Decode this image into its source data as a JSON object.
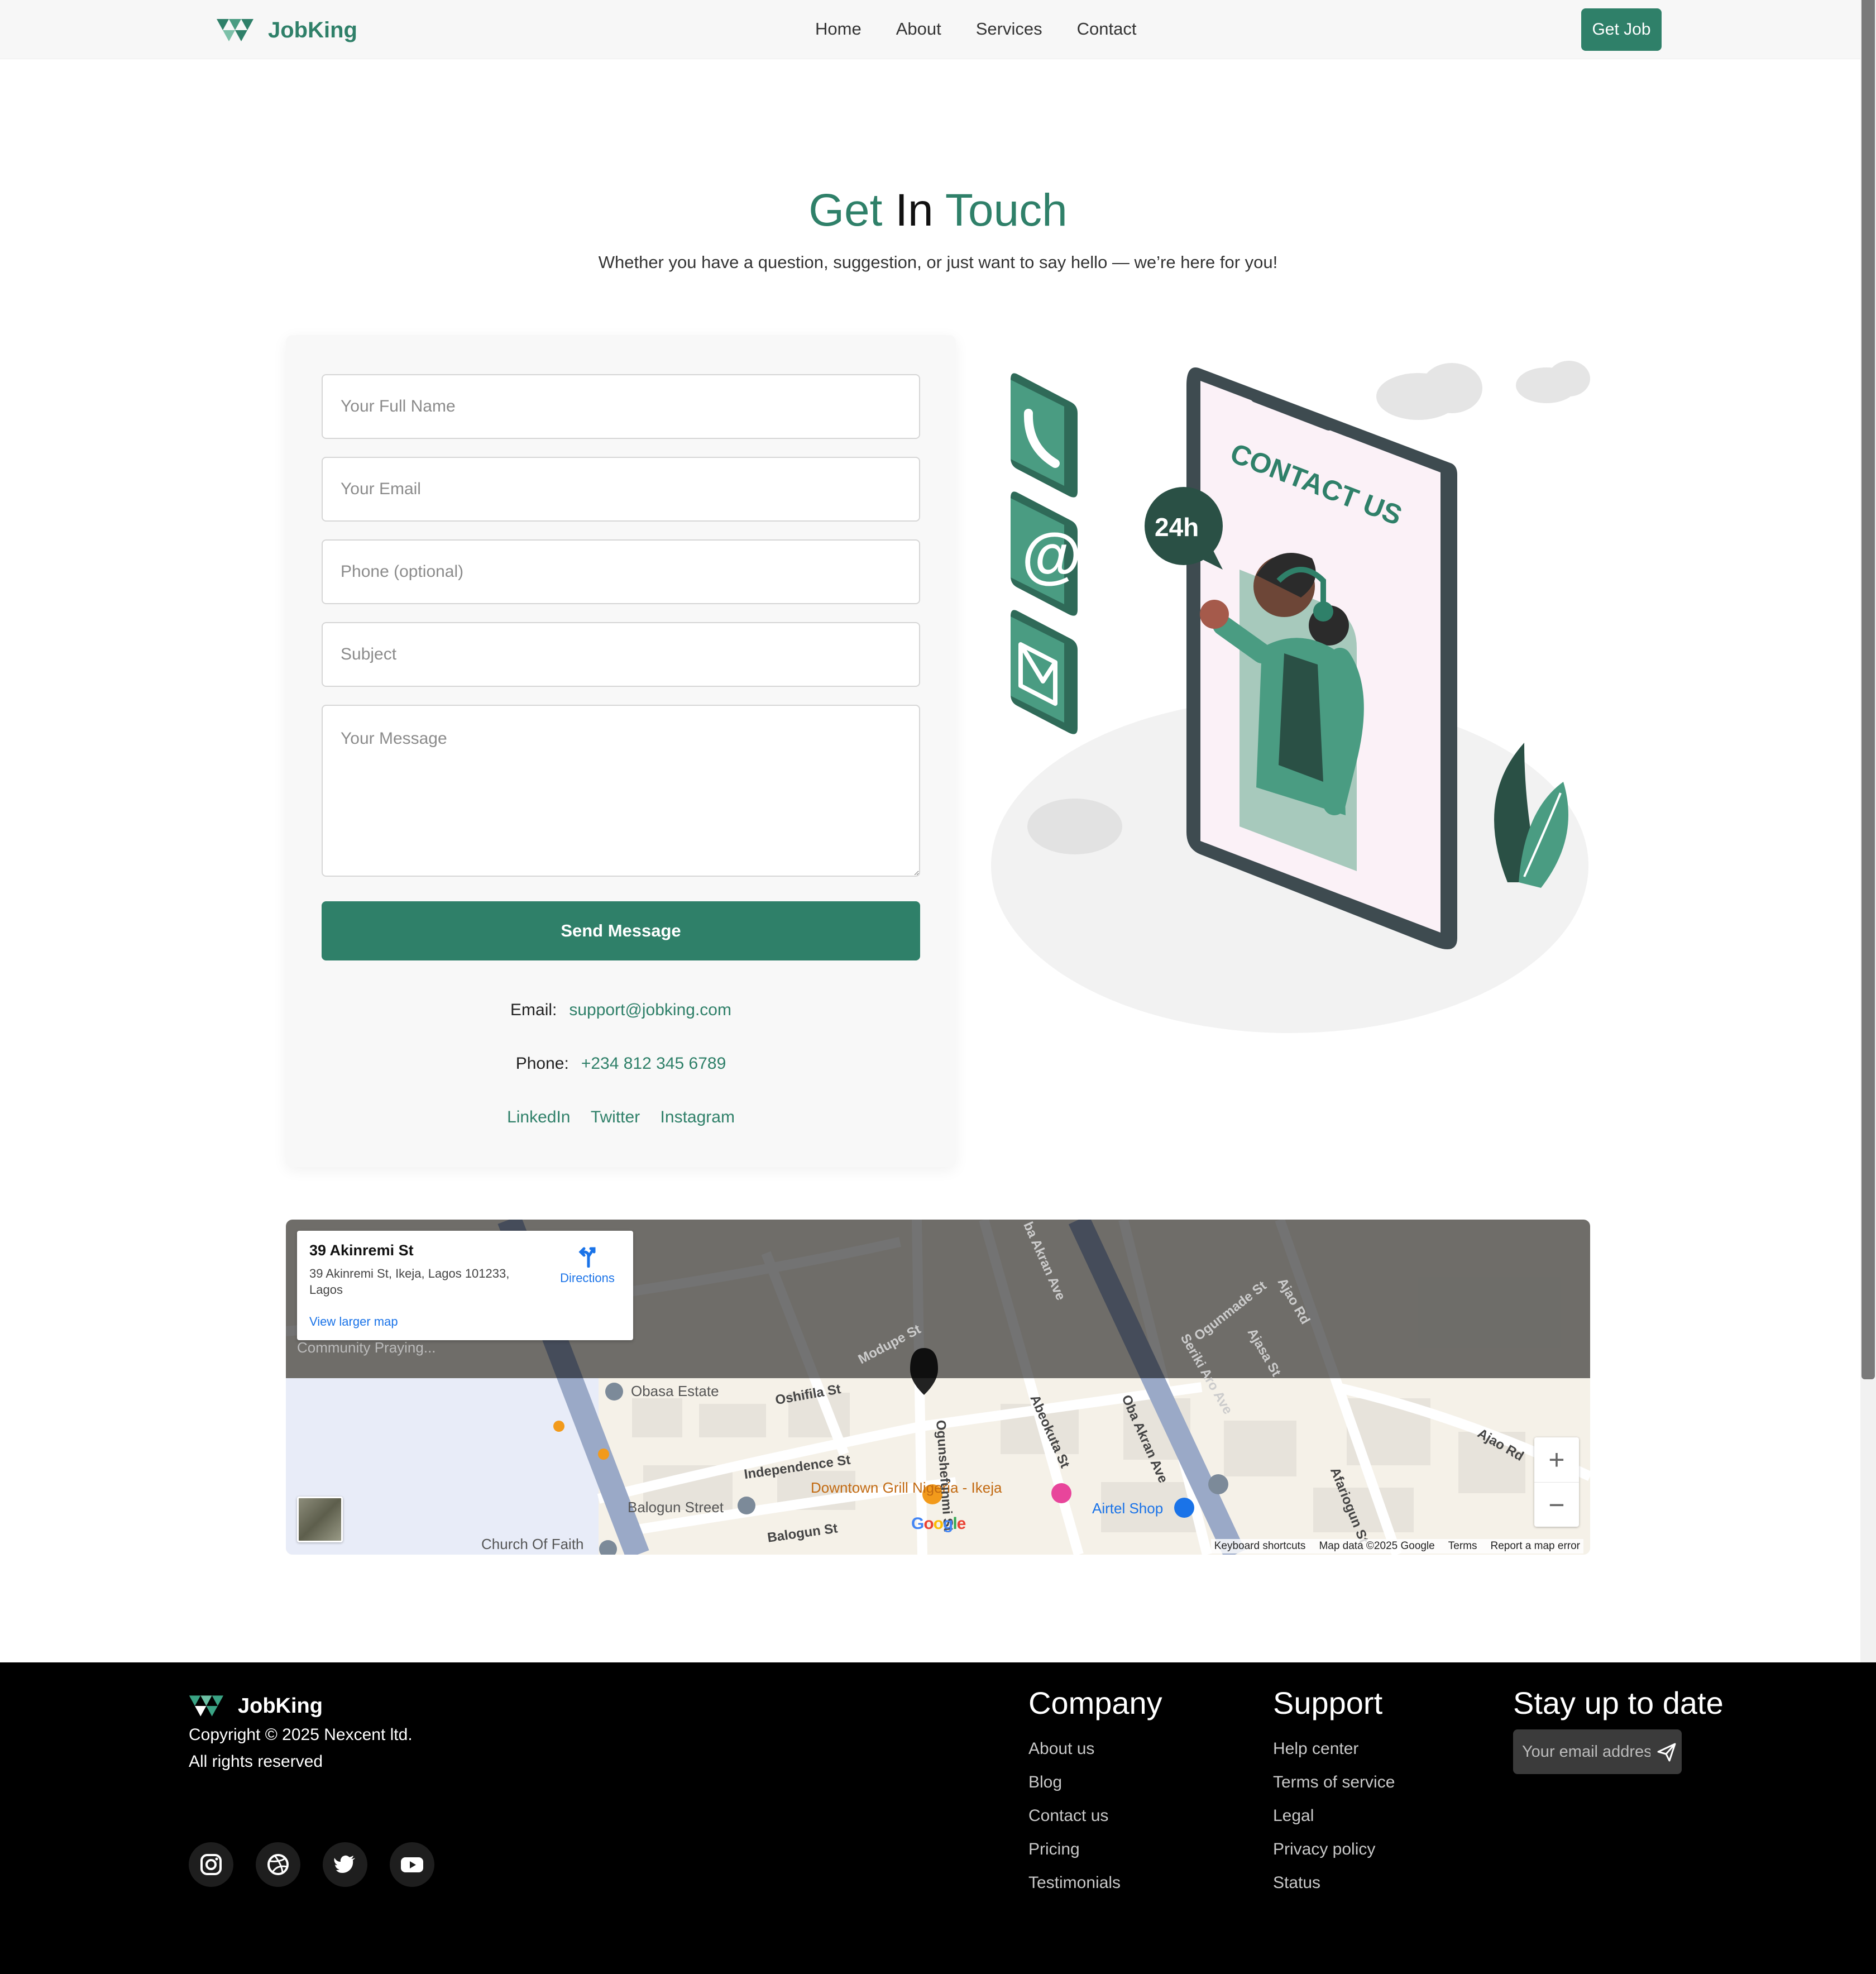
{
  "brand": {
    "name": "JobKing",
    "accent": "#2f8069"
  },
  "nav": {
    "links": [
      "Home",
      "About",
      "Services",
      "Contact"
    ],
    "cta": "Get Job"
  },
  "hero": {
    "title_part1": "Get",
    "title_part2": "In",
    "title_part3": "Touch",
    "subtitle": "Whether you have a question, suggestion, or just want to say hello — we’re here for you!"
  },
  "form": {
    "name_placeholder": "Your Full Name",
    "email_placeholder": "Your Email",
    "phone_placeholder": "Phone (optional)",
    "subject_placeholder": "Subject",
    "message_placeholder": "Your Message",
    "submit": "Send Message"
  },
  "contact_info": {
    "email_label": "Email:",
    "email": "support@jobking.com",
    "phone_label": "Phone:",
    "phone": "+234 812 345 6789",
    "socials": [
      "LinkedIn",
      "Twitter",
      "Instagram"
    ]
  },
  "illustration": {
    "screen_text": "CONTACT US",
    "badge": "24h"
  },
  "map": {
    "place_title": "39 Akinremi St",
    "place_address": "39 Akinremi St, Ikeja, Lagos 101233, Lagos",
    "directions": "Directions",
    "larger_map": "View larger map",
    "labels": {
      "community": "Community Praying...",
      "obasa": "Obasa Estate",
      "oshifila": "Oshifila St",
      "modupe": "Modupe St",
      "independence": "Independence St",
      "balogun_street": "Balogun Street",
      "balogun_st": "Balogun St",
      "church": "Church Of Faith",
      "downtown": "Downtown Grill Nigeria - Ikeja",
      "airtel": "Airtel Shop",
      "ogunshefunmi": "Ogunshefunmi St",
      "abeokuta": "Abeokuta St",
      "oba_akran": "Oba Akran Ave",
      "oba_akran_top": "ba Akran Ave",
      "seriki": "Seriki Aro Ave",
      "ogunmade": "Ogunmade St",
      "ajao_rd": "Ajao Rd",
      "ajasa": "Ajasa St",
      "afariogun": "Afariogun St",
      "ajao_rd2": "Ajao Rd"
    },
    "google": "Google",
    "footer": [
      "Keyboard shortcuts",
      "Map data ©2025 Google",
      "Terms",
      "Report a map error"
    ]
  },
  "footer": {
    "brand": "JobKing",
    "copyright": "Copyright © 2025 Nexcent ltd.",
    "rights": "All rights reserved",
    "social_icons": [
      "instagram-icon",
      "dribbble-icon",
      "twitter-icon",
      "youtube-icon"
    ],
    "company": {
      "heading": "Company",
      "links": [
        "About us",
        "Blog",
        "Contact us",
        "Pricing",
        "Testimonials"
      ]
    },
    "support": {
      "heading": "Support",
      "links": [
        "Help center",
        "Terms of service",
        "Legal",
        "Privacy policy",
        "Status"
      ]
    },
    "subscribe": {
      "heading": "Stay up to date",
      "placeholder": "Your email address"
    }
  }
}
